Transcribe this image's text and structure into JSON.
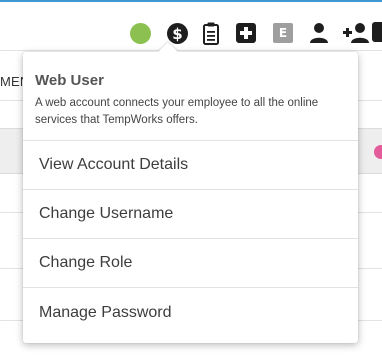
{
  "toolbar": {
    "icons": [
      {
        "name": "status-online-dot",
        "color": "#8cc152"
      },
      {
        "name": "dollar-icon",
        "glyph": "$"
      },
      {
        "name": "clipboard-icon"
      },
      {
        "name": "medical-plus-icon"
      },
      {
        "name": "e-badge-icon",
        "glyph": "E"
      },
      {
        "name": "person-icon"
      },
      {
        "name": "person-add-icon"
      }
    ]
  },
  "background": {
    "column_header": "MEN"
  },
  "dropdown": {
    "title": "Web User",
    "description": "A web account connects your employee to all the online services that TempWorks offers.",
    "items": [
      {
        "label": "View Account Details"
      },
      {
        "label": "Change Username"
      },
      {
        "label": "Change Role"
      },
      {
        "label": "Manage Password"
      }
    ]
  },
  "colors": {
    "accent": "#3f9ad4",
    "status_green": "#8cc152",
    "badge_pink": "#e35b9b"
  }
}
